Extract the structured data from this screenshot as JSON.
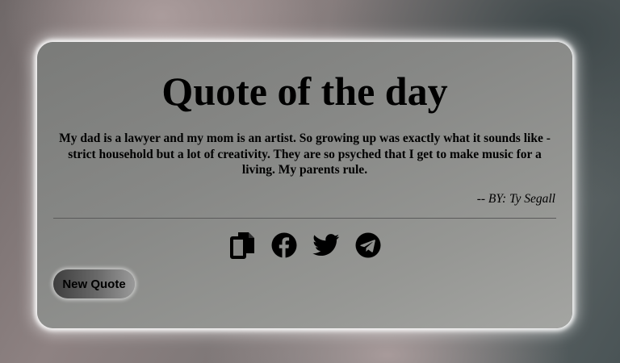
{
  "card": {
    "title": "Quote of the day",
    "quote": "My dad is a lawyer and my mom is an artist. So growing up was exactly what it sounds like - strict household but a lot of creativity. They are so psyched that I get to make music for a living. My parents rule.",
    "author": "-- BY: Ty Segall"
  },
  "share_icons": [
    "copy-icon",
    "facebook-icon",
    "twitter-icon",
    "telegram-icon"
  ],
  "button": {
    "new_quote_label": "New Quote"
  },
  "colors": {
    "card_glow": "#ffffff",
    "text": "#000000"
  }
}
